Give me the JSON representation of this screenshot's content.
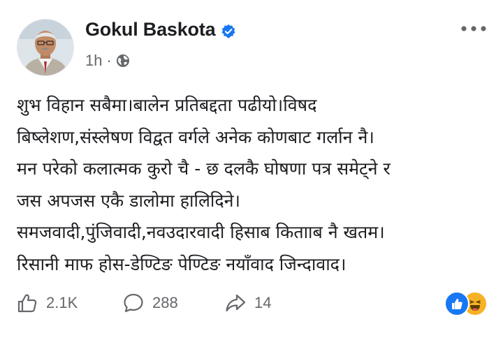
{
  "post": {
    "author": "Gokul Baskota",
    "time": "1h",
    "separator": "·",
    "text_lines": [
      "शुभ विहान सबैमा।बालेन प्रतिबद्दता पढीयो।विषद",
      "बिष्लेशण,संस्लेषण विद्वत वर्गले अनेक कोणबाट गर्लान नै।",
      "मन परेको कलात्मक कुरो चै - छ दलकै घोषणा पत्र समेट्ने र",
      "जस अपजस एकै डालोमा हालिदिने।",
      "समजवादी,पुंजिवादी,नवउदारवादी हिसाब कितााब नै खतम।",
      "रिसानी माफ होस-डेण्टिङ पेण्टिङ नयाँवाद जिन्दावाद।"
    ]
  },
  "actions": {
    "like_count": "2.1K",
    "comment_count": "288",
    "share_count": "14"
  },
  "icons": {
    "verified": "verified-badge-icon",
    "audience": "globe-icon",
    "more": "more-options-icon",
    "like": "thumbs-up-icon",
    "comment": "comment-bubble-icon",
    "share": "share-arrow-icon",
    "reactions": [
      "like-reaction-icon",
      "haha-reaction-icon"
    ]
  },
  "colors": {
    "accent": "#1877f2",
    "secondary_text": "#65676b",
    "haha": "#f7b125"
  }
}
